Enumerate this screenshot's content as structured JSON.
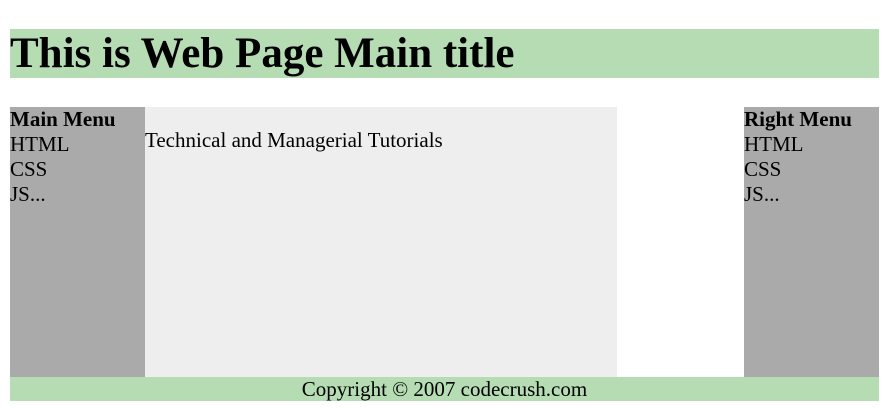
{
  "header": {
    "title": "This is Web Page Main title"
  },
  "left_menu": {
    "title": "Main Menu",
    "items": [
      "HTML",
      "CSS",
      "JS..."
    ]
  },
  "content": {
    "text": "Technical and Managerial Tutorials"
  },
  "right_menu": {
    "title": "Right Menu",
    "items": [
      "HTML",
      "CSS",
      "JS..."
    ]
  },
  "footer": {
    "text": "Copyright © 2007 codecrush.com"
  },
  "colors": {
    "header_footer_bg": "#b5dcb3",
    "menu_bg": "#aaaaaa",
    "content_bg": "#eeeeee",
    "page_bg": "#ffffff"
  }
}
